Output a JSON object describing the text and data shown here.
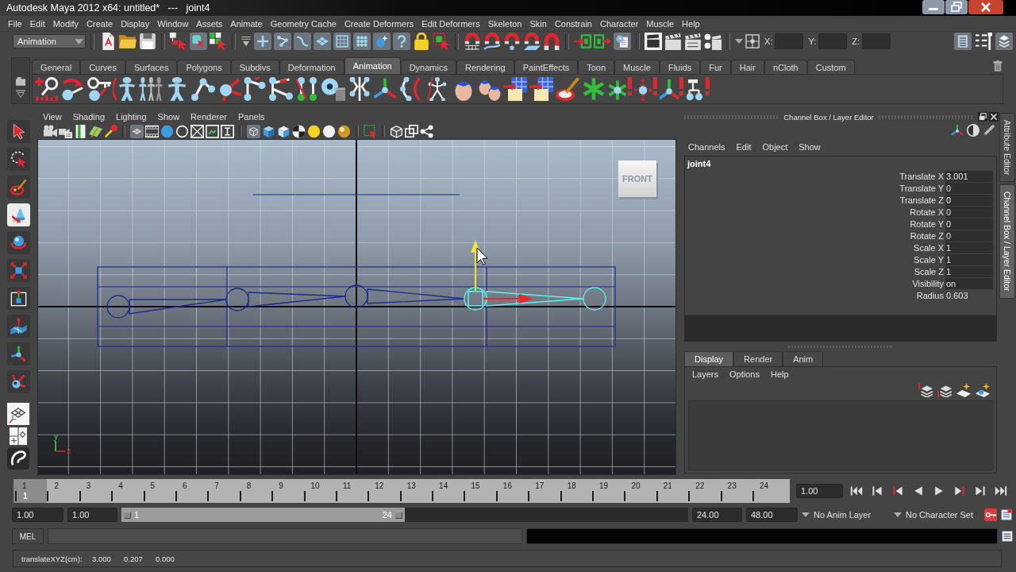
{
  "window": {
    "title": "Autodesk Maya 2012 x64: untitled*   ---   joint4"
  },
  "menu_bar": [
    "File",
    "Edit",
    "Modify",
    "Create",
    "Display",
    "Window",
    "Assets",
    "Animate",
    "Geometry Cache",
    "Create Deformers",
    "Edit Deformers",
    "Skeleton",
    "Skin",
    "Constrain",
    "Character",
    "Muscle",
    "Help"
  ],
  "status_line": {
    "menu_set": "Animation",
    "groups": [
      [
        {
          "kind": "page",
          "on": false
        },
        {
          "kind": "folder",
          "on": false
        },
        {
          "kind": "disk",
          "on": false
        }
      ],
      [
        {
          "kind": "hierarchy",
          "on": false
        },
        {
          "kind": "object",
          "on": true
        },
        {
          "kind": "component",
          "on": false
        }
      ],
      [
        {
          "kind": "cross",
          "on": true
        },
        {
          "kind": "joint",
          "on": true
        },
        {
          "kind": "curve",
          "on": true
        },
        {
          "kind": "surface",
          "on": true
        },
        {
          "kind": "lattice",
          "on": true
        },
        {
          "kind": "particles",
          "on": true
        },
        {
          "kind": "light",
          "on": true
        },
        {
          "kind": "question",
          "on": true
        },
        {
          "kind": "lock",
          "on": false
        },
        {
          "kind": "highlight",
          "on": false
        }
      ],
      [
        {
          "kind": "snapgrid",
          "on": false
        },
        {
          "kind": "snapcurve",
          "on": false
        },
        {
          "kind": "snappoint",
          "on": false
        },
        {
          "kind": "snapview",
          "on": false
        },
        {
          "kind": "snaplive",
          "on": false
        }
      ],
      [
        {
          "kind": "input",
          "on": false
        },
        {
          "kind": "output",
          "on": false
        },
        {
          "kind": "history",
          "on": true
        }
      ],
      [
        {
          "kind": "renderview",
          "on": false
        },
        {
          "kind": "clapper",
          "on": false
        },
        {
          "kind": "ipr",
          "on": false
        },
        {
          "kind": "settings",
          "on": false
        }
      ]
    ],
    "coordinate_labels": [
      "X:",
      "Y:",
      "Z:"
    ],
    "panel_toggles": [
      {
        "kind": "attrs",
        "on": true
      },
      {
        "kind": "toolset",
        "on": false
      },
      {
        "kind": "cbox",
        "on": true
      }
    ]
  },
  "shelf": {
    "tabs": [
      {
        "label": "General",
        "selected": false
      },
      {
        "label": "Curves",
        "selected": false
      },
      {
        "label": "Surfaces",
        "selected": false
      },
      {
        "label": "Polygons",
        "selected": false
      },
      {
        "label": "Subdivs",
        "selected": false
      },
      {
        "label": "Deformation",
        "selected": false
      },
      {
        "label": "Animation",
        "selected": true
      },
      {
        "label": "Dynamics",
        "selected": false
      },
      {
        "label": "Rendering",
        "selected": false
      },
      {
        "label": "PaintEffects",
        "selected": false
      },
      {
        "label": "Toon",
        "selected": false
      },
      {
        "label": "Muscle",
        "selected": false
      },
      {
        "label": "Fluids",
        "selected": false
      },
      {
        "label": "Fur",
        "selected": false
      },
      {
        "label": "Hair",
        "selected": false
      },
      {
        "label": "nCloth",
        "selected": false
      },
      {
        "label": "Custom",
        "selected": false
      }
    ]
  },
  "toolbox": {
    "tools": [
      {
        "kind": "select",
        "selected": false
      },
      {
        "kind": "lasso",
        "selected": false
      },
      {
        "kind": "paintsel",
        "selected": false
      },
      {
        "kind": "move",
        "selected": true
      },
      {
        "kind": "rotate",
        "selected": false
      },
      {
        "kind": "scale",
        "selected": false
      },
      {
        "kind": "universal",
        "selected": false
      },
      {
        "kind": "softmod",
        "selected": false
      },
      {
        "kind": "showmanip",
        "selected": false
      },
      {
        "kind": "lasttool",
        "selected": false
      }
    ]
  },
  "panel": {
    "menu": [
      "View",
      "Shading",
      "Lighting",
      "Show",
      "Renderer",
      "Panels"
    ],
    "toolbar": [
      [
        {
          "kind": "camera",
          "on": false
        },
        {
          "kind": "camlist",
          "on": false
        },
        {
          "kind": "bookmark",
          "on": false
        },
        {
          "kind": "imgplane",
          "on": false
        },
        {
          "kind": "panzoom",
          "on": false
        }
      ],
      [
        {
          "kind": "gridplane",
          "on": true
        },
        {
          "kind": "filmgate",
          "on": false
        },
        {
          "kind": "sphereb",
          "on": false
        },
        {
          "kind": "ring",
          "on": false
        },
        {
          "kind": "xbox",
          "on": false
        },
        {
          "kind": "safe",
          "on": false
        },
        {
          "kind": "ibeam",
          "on": false
        }
      ],
      [
        {
          "kind": "wirecube",
          "on": true
        },
        {
          "kind": "shadedcube",
          "on": false
        },
        {
          "kind": "litcube",
          "on": false
        },
        {
          "kind": "checker",
          "on": false
        },
        {
          "kind": "ysphere",
          "on": false
        },
        {
          "kind": "wsphere",
          "on": false
        },
        {
          "kind": "gsphere",
          "on": false
        }
      ],
      [
        {
          "kind": "isolate",
          "on": false
        }
      ],
      [
        {
          "kind": "cube",
          "on": false
        },
        {
          "kind": "squares",
          "on": false
        },
        {
          "kind": "share",
          "on": false
        }
      ]
    ],
    "view_cube": "FRONT",
    "axis_labels": [
      "y",
      "x"
    ]
  },
  "channel_box": {
    "title": "Channel Box / Layer Editor",
    "menu": [
      "Channels",
      "Edit",
      "Object",
      "Show"
    ],
    "node": "joint4",
    "channels": [
      {
        "name": "Translate X",
        "value": "3.001",
        "kind": "field"
      },
      {
        "name": "Translate Y",
        "value": "0",
        "kind": "field"
      },
      {
        "name": "Translate Z",
        "value": "0",
        "kind": "field"
      },
      {
        "name": "Rotate X",
        "value": "0",
        "kind": "field"
      },
      {
        "name": "Rotate Y",
        "value": "0",
        "kind": "field"
      },
      {
        "name": "Rotate Z",
        "value": "0",
        "kind": "field"
      },
      {
        "name": "Scale X",
        "value": "1",
        "kind": "field"
      },
      {
        "name": "Scale Y",
        "value": "1",
        "kind": "field"
      },
      {
        "name": "Scale Z",
        "value": "1",
        "kind": "field"
      },
      {
        "name": "Visibility",
        "value": "on",
        "kind": "field"
      },
      {
        "name": "Radius",
        "value": "0.603",
        "kind": "plain"
      }
    ]
  },
  "layer_editor": {
    "tabs": [
      {
        "label": "Display",
        "selected": true
      },
      {
        "label": "Render",
        "selected": false
      },
      {
        "label": "Anim",
        "selected": false
      }
    ],
    "menu": [
      "Layers",
      "Options",
      "Help"
    ]
  },
  "side_tabs": [
    {
      "label": "Attribute Editor",
      "selected": false
    },
    {
      "label": "Channel Box / Layer Editor",
      "selected": true
    }
  ],
  "time_slider": {
    "frames": [
      "1",
      "2",
      "3",
      "4",
      "5",
      "6",
      "7",
      "8",
      "9",
      "10",
      "11",
      "12",
      "13",
      "14",
      "15",
      "16",
      "17",
      "18",
      "19",
      "20",
      "21",
      "22",
      "23",
      "24"
    ],
    "level": 0,
    "current_frame": "1",
    "current_time": "1.00"
  },
  "range_slider": {
    "start": "1.00",
    "range_start": "1.00",
    "handle_start": "1",
    "handle_end": "24",
    "level": 0.5,
    "range_end": "24.00",
    "end": "48.00",
    "anim_layer": "No Anim Layer",
    "character_set": "No Character Set"
  },
  "command_line": {
    "label": "MEL"
  },
  "help_line": {
    "label": "translateXYZ(cm):",
    "values": [
      "3.000",
      "0.207",
      "0.000"
    ]
  }
}
